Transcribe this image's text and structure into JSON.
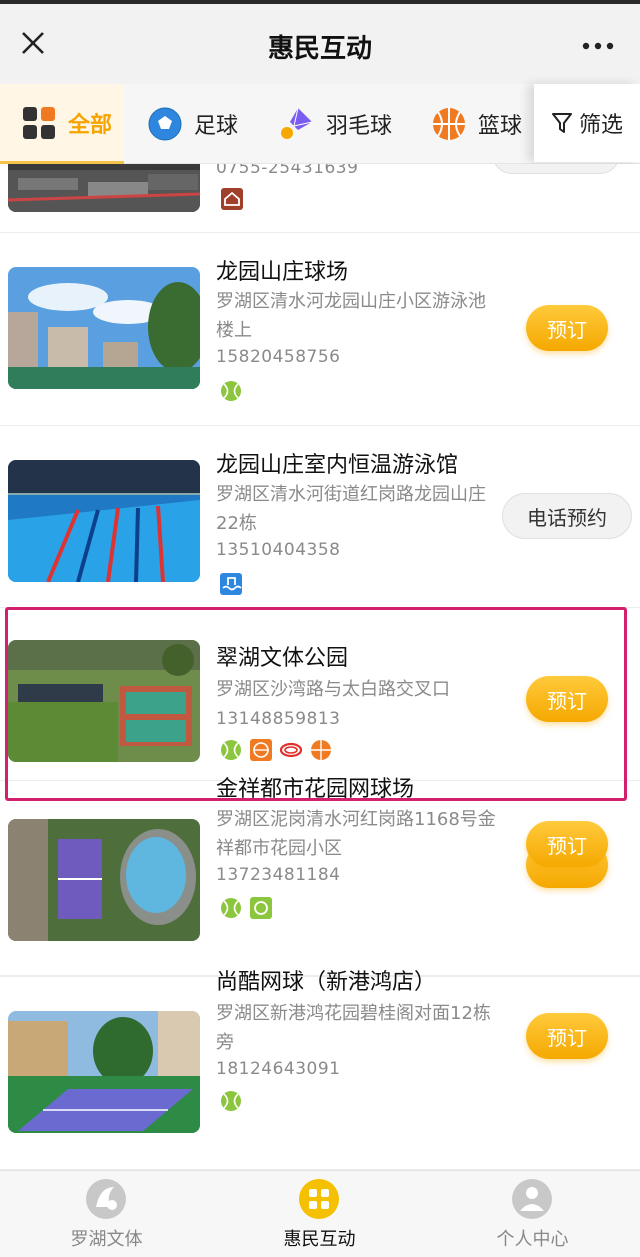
{
  "header": {
    "title": "惠民互动"
  },
  "tabs": [
    {
      "label": "全部"
    },
    {
      "label": "足球"
    },
    {
      "label": "羽毛球"
    },
    {
      "label": "篮球"
    }
  ],
  "filter": {
    "label": "筛选"
  },
  "venues": [
    {
      "phone": "0755-25431639"
    },
    {
      "name": "龙园山庄球场",
      "address": "罗湖区清水河龙园山庄小区游泳池楼上",
      "phone": "15820458756",
      "action": "预订"
    },
    {
      "name": "龙园山庄室内恒温游泳馆",
      "address": "罗湖区清水河街道红岗路龙园山庄22栋",
      "phone": "13510404358",
      "action": "电话预约"
    },
    {
      "name": "翠湖文体公园",
      "address": "罗湖区沙湾路与太白路交叉口",
      "phone": "13148859813",
      "action": "预订"
    },
    {
      "name": "金祥都市花园网球场",
      "address": "罗湖区泥岗清水河红岗路1168号金祥都市花园小区",
      "phone": "13723481184",
      "action": "预订"
    },
    {
      "name": "尚酷网球（新港鸿店）",
      "address": "罗湖区新港鸿花园碧桂阁对面12栋旁",
      "phone": "18124643091",
      "action": "预订"
    }
  ],
  "bottom_nav": [
    {
      "label": "罗湖文体"
    },
    {
      "label": "惠民互动"
    },
    {
      "label": "个人中心"
    }
  ],
  "colors": {
    "accent": "#f5a800",
    "highlight": "#d21f6e"
  }
}
